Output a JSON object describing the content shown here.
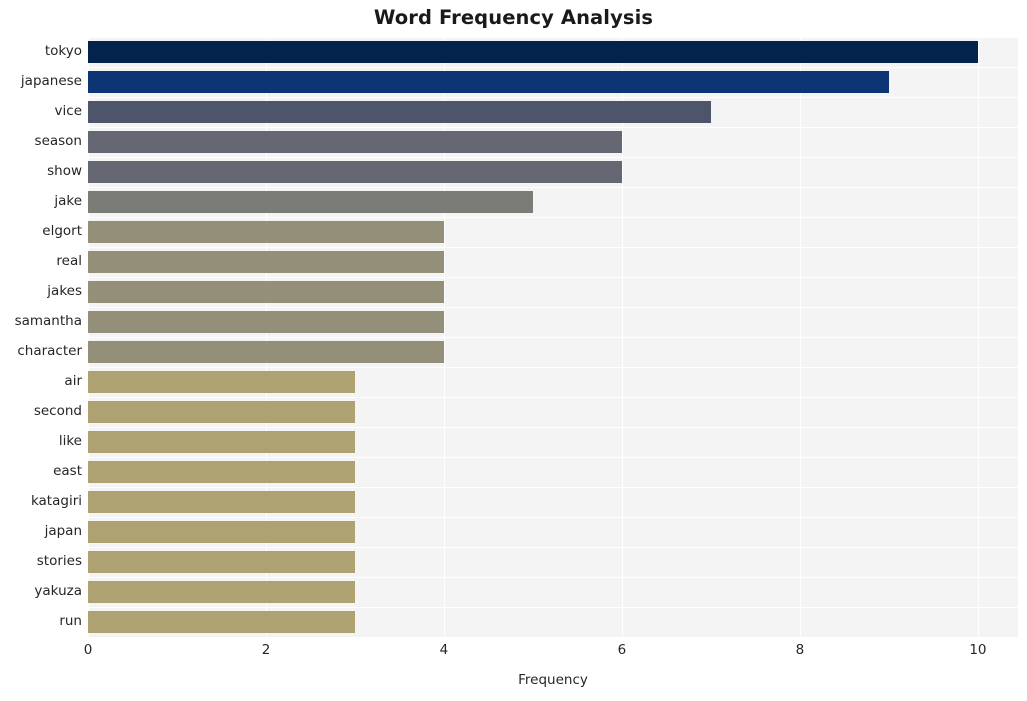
{
  "chart_data": {
    "type": "bar",
    "orientation": "horizontal",
    "title": "Word Frequency Analysis",
    "xlabel": "Frequency",
    "ylabel": "",
    "xlim": [
      0,
      10.45
    ],
    "xticks": [
      0,
      2,
      4,
      6,
      8,
      10
    ],
    "xtick_labels": [
      "0",
      "2",
      "4",
      "6",
      "8",
      "10"
    ],
    "grid": true,
    "grid_axis": "both",
    "legend": null,
    "categories": [
      "tokyo",
      "japanese",
      "vice",
      "season",
      "show",
      "jake",
      "elgort",
      "real",
      "jakes",
      "samantha",
      "character",
      "air",
      "second",
      "like",
      "east",
      "katagiri",
      "japan",
      "stories",
      "yakuza",
      "run"
    ],
    "values": [
      10,
      9,
      7,
      6,
      6,
      5,
      4,
      4,
      4,
      4,
      4,
      3,
      3,
      3,
      3,
      3,
      3,
      3,
      3,
      3
    ],
    "bar_colors": [
      "#03234d",
      "#0d3573",
      "#4e556b",
      "#656872",
      "#656872",
      "#7b7b77",
      "#938f79",
      "#938f79",
      "#938f79",
      "#938f79",
      "#938f79",
      "#aea273",
      "#aea273",
      "#aea273",
      "#aea273",
      "#aea273",
      "#aea273",
      "#aea273",
      "#aea273",
      "#aea273"
    ]
  },
  "style": {
    "plot_background": "#f4f4f5",
    "figure_background": "#ffffff",
    "gridline_color": "#ffffff",
    "text_color": "#262626",
    "title_color": "#1a1a1a"
  }
}
